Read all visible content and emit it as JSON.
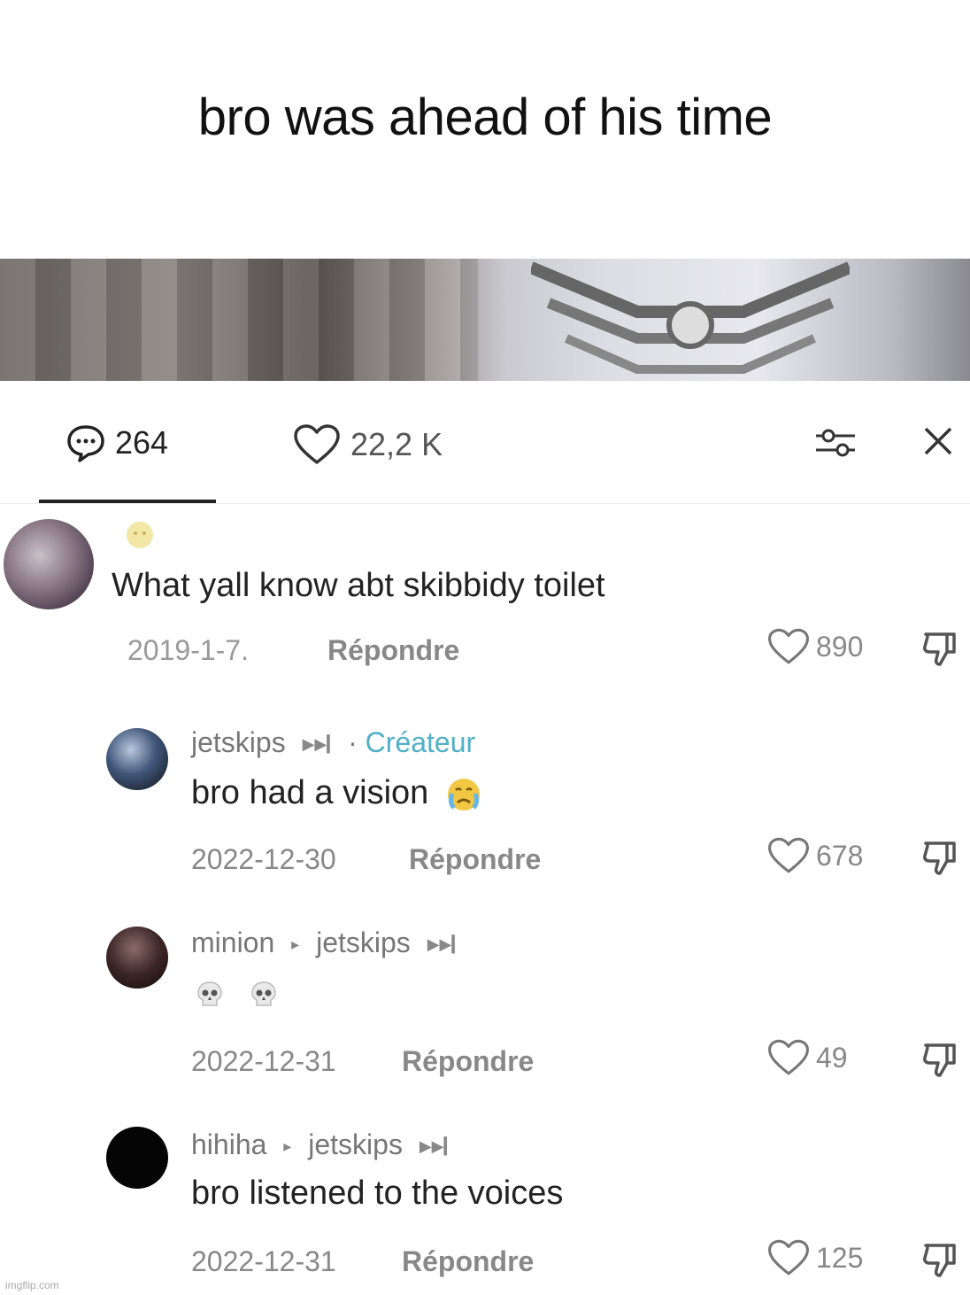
{
  "caption": {
    "text": "bro was ahead of his time"
  },
  "tabs": {
    "comments_count": "264",
    "likes_count": "22,2 K"
  },
  "icons": {
    "comments": "comment-bubble-icon",
    "likes": "heart-icon",
    "filter": "sliders-icon",
    "close": "close-icon",
    "dislike": "thumbs-down-icon"
  },
  "comments": [
    {
      "username": "",
      "text": "What yall know abt skibbidy toilet",
      "date": "2019-1-7.",
      "reply": "Répondre",
      "likes": "890"
    },
    {
      "username": "jetskips",
      "tag": "·",
      "creator_label": "Créateur",
      "text": "bro had a vision",
      "date": "2022-12-30",
      "reply": "Répondre",
      "likes": "678"
    },
    {
      "username": "minion",
      "reply_to": "jetskips",
      "text": "",
      "date": "2022-12-31",
      "reply": "Répondre",
      "likes": "49"
    },
    {
      "username": "hihiha",
      "reply_to": "jetskips",
      "text": "bro listened to the voices",
      "date": "2022-12-31",
      "reply": "Répondre",
      "likes": "125"
    }
  ],
  "watermark": "imgflip.com",
  "colors": {
    "creator": "#4fb0c6",
    "text": "#222222",
    "muted": "#888888"
  }
}
